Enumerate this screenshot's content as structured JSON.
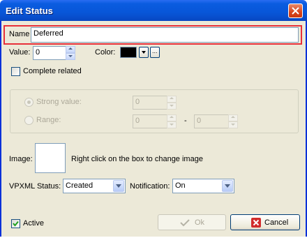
{
  "window": {
    "title": "Edit Status"
  },
  "name": {
    "label": "Name",
    "value": "Deferred"
  },
  "value_field": {
    "label": "Value:",
    "value": "0"
  },
  "color": {
    "label": "Color:",
    "swatch": "#000000",
    "more_label": "..."
  },
  "complete_related": {
    "label": "Complete related",
    "checked": false
  },
  "strong_value": {
    "label": "Strong value:",
    "value": "0"
  },
  "range": {
    "label": "Range:",
    "from": "0",
    "separator": "-",
    "to": "0"
  },
  "image": {
    "label": "Image:",
    "hint": "Right click on the box to  change image"
  },
  "vpxml_status": {
    "label": "VPXML Status:",
    "selected": "Created"
  },
  "notification": {
    "label": "Notification:",
    "selected": "On"
  },
  "active": {
    "label": "Active",
    "checked": true
  },
  "buttons": {
    "ok_label": "Ok",
    "cancel_label": "Cancel"
  },
  "colors": {
    "title_bar": "#0a5ce0",
    "highlight": "#e8303a",
    "cancel_icon": "#d12c2c"
  }
}
